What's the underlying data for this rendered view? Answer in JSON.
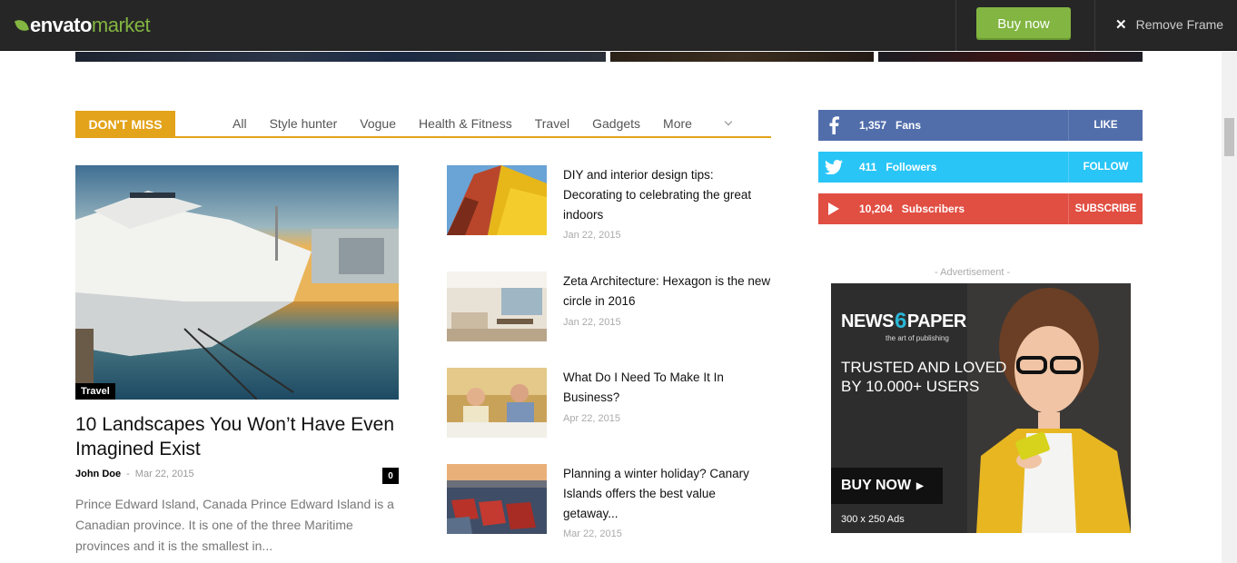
{
  "topbar": {
    "logo_envato": "envato",
    "logo_market": "market",
    "buy_label": "Buy now",
    "remove_label": "Remove Frame",
    "accent": "#82b541"
  },
  "dont_miss": {
    "title": "DON'T MISS",
    "tabs": [
      "All",
      "Style hunter",
      "Vogue",
      "Health & Fitness",
      "Travel",
      "Gadgets",
      "More"
    ],
    "accent": "#e3a31a"
  },
  "featured": {
    "category": "Travel",
    "title": "10 Landscapes You Won’t Have Even Imagined Exist",
    "author": "John Doe",
    "separator": "-",
    "date": "Mar 22, 2015",
    "comments": "0",
    "excerpt": "Prince Edward Island, Canada Prince Edward Island is a Canadian province. It is one of the three Maritime provinces and it is the smallest in..."
  },
  "posts": [
    {
      "title": "DIY and interior design tips: Decorating to celebrating the great indoors",
      "date": "Jan 22, 2015"
    },
    {
      "title": "Zeta Architecture: Hexagon is the new circle in 2016",
      "date": "Jan 22, 2015"
    },
    {
      "title": "What Do I Need To Make It In Business?",
      "date": "Apr 22, 2015"
    },
    {
      "title": "Planning a winter holiday? Canary Islands offers the best value getaway...",
      "date": "Mar 22, 2015"
    }
  ],
  "social": {
    "facebook": {
      "icon": "facebook-icon",
      "count": "1,357",
      "label": "Fans",
      "action": "LIKE",
      "color": "#516eab"
    },
    "twitter": {
      "icon": "twitter-icon",
      "count": "411",
      "label": "Followers",
      "action": "FOLLOW",
      "color": "#29c5f6"
    },
    "youtube": {
      "icon": "youtube-icon",
      "count": "10,204",
      "label": "Subscribers",
      "action": "SUBSCRIBE",
      "color": "#e14e42"
    }
  },
  "ad": {
    "label": "- Advertisement -",
    "logo_left": "NEWS",
    "logo_six": "6",
    "logo_right": "PAPER",
    "tagline": "the art of publishing",
    "headline": "TRUSTED AND LOVED BY 10.000+ USERS",
    "buy": "BUY NOW",
    "size": "300 x 250 Ads"
  }
}
